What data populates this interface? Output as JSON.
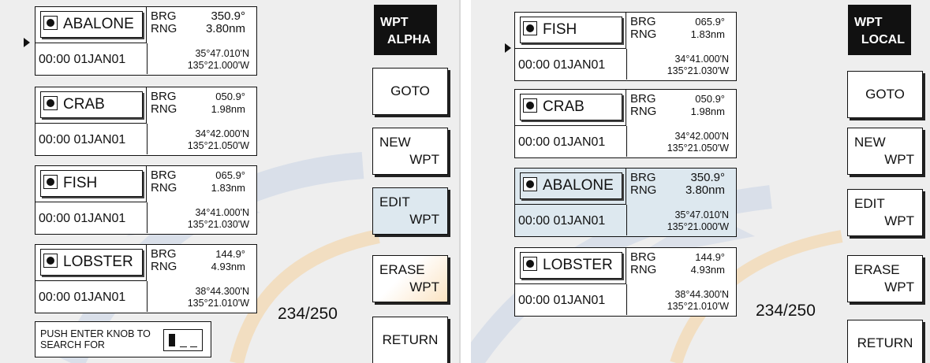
{
  "left": {
    "header": {
      "line1": "WPT",
      "line2": "ALPHA"
    },
    "cards": [
      {
        "name": "ABALONE",
        "brg_label": "BRG",
        "brg": "350.9°",
        "rng_label": "RNG",
        "rng": "3.80nm",
        "time": "00:00 01JAN01",
        "lat": "35°47.010'N",
        "lon": "135°21.000'W"
      },
      {
        "name": "CRAB",
        "brg_label": "BRG",
        "brg": "050.9°",
        "rng_label": "RNG",
        "rng": "1.98nm",
        "time": "00:00 01JAN01",
        "lat": "34°42.000'N",
        "lon": "135°21.050'W"
      },
      {
        "name": "FISH",
        "brg_label": "BRG",
        "brg": "065.9°",
        "rng_label": "RNG",
        "rng": "1.83nm",
        "time": "00:00 01JAN01",
        "lat": "34°41.000'N",
        "lon": "135°21.030'W"
      },
      {
        "name": "LOBSTER",
        "brg_label": "BRG",
        "brg": "144.9°",
        "rng_label": "RNG",
        "rng": "4.93nm",
        "time": "00:00 01JAN01",
        "lat": "38°44.300'N",
        "lon": "135°21.010'W"
      }
    ],
    "buttons": {
      "goto": "GOTO",
      "new_l1": "NEW",
      "new_l2": "WPT",
      "edit_l1": "EDIT",
      "edit_l2": "WPT",
      "erase_l1": "ERASE",
      "erase_l2": "WPT",
      "return": "RETURN"
    },
    "counter": "234/250",
    "search_text": "PUSH ENTER KNOB TO SEARCH FOR"
  },
  "right": {
    "header": {
      "line1": "WPT",
      "line2": "LOCAL"
    },
    "cards": [
      {
        "name": "FISH",
        "brg_label": "BRG",
        "brg": "065.9°",
        "rng_label": "RNG",
        "rng": "1.83nm",
        "time": "00:00 01JAN01",
        "lat": "34°41.000'N",
        "lon": "135°21.030'W"
      },
      {
        "name": "CRAB",
        "brg_label": "BRG",
        "brg": "050.9°",
        "rng_label": "RNG",
        "rng": "1.98nm",
        "time": "00:00 01JAN01",
        "lat": "34°42.000'N",
        "lon": "135°21.050'W"
      },
      {
        "name": "ABALONE",
        "brg_label": "BRG",
        "brg": "350.9°",
        "rng_label": "RNG",
        "rng": "3.80nm",
        "time": "00:00 01JAN01",
        "lat": "35°47.010'N",
        "lon": "135°21.000'W"
      },
      {
        "name": "LOBSTER",
        "brg_label": "BRG",
        "brg": "144.9°",
        "rng_label": "RNG",
        "rng": "4.93nm",
        "time": "00:00 01JAN01",
        "lat": "38°44.300'N",
        "lon": "135°21.010'W"
      }
    ],
    "buttons": {
      "goto": "GOTO",
      "new_l1": "NEW",
      "new_l2": "WPT",
      "edit_l1": "EDIT",
      "edit_l2": "WPT",
      "erase_l1": "ERASE",
      "erase_l2": "WPT",
      "return": "RETURN"
    },
    "counter": "234/250"
  },
  "colors": {
    "highlight": "#dde8ef",
    "header_bg": "#111111",
    "panel_bg": "#eeeeee"
  }
}
